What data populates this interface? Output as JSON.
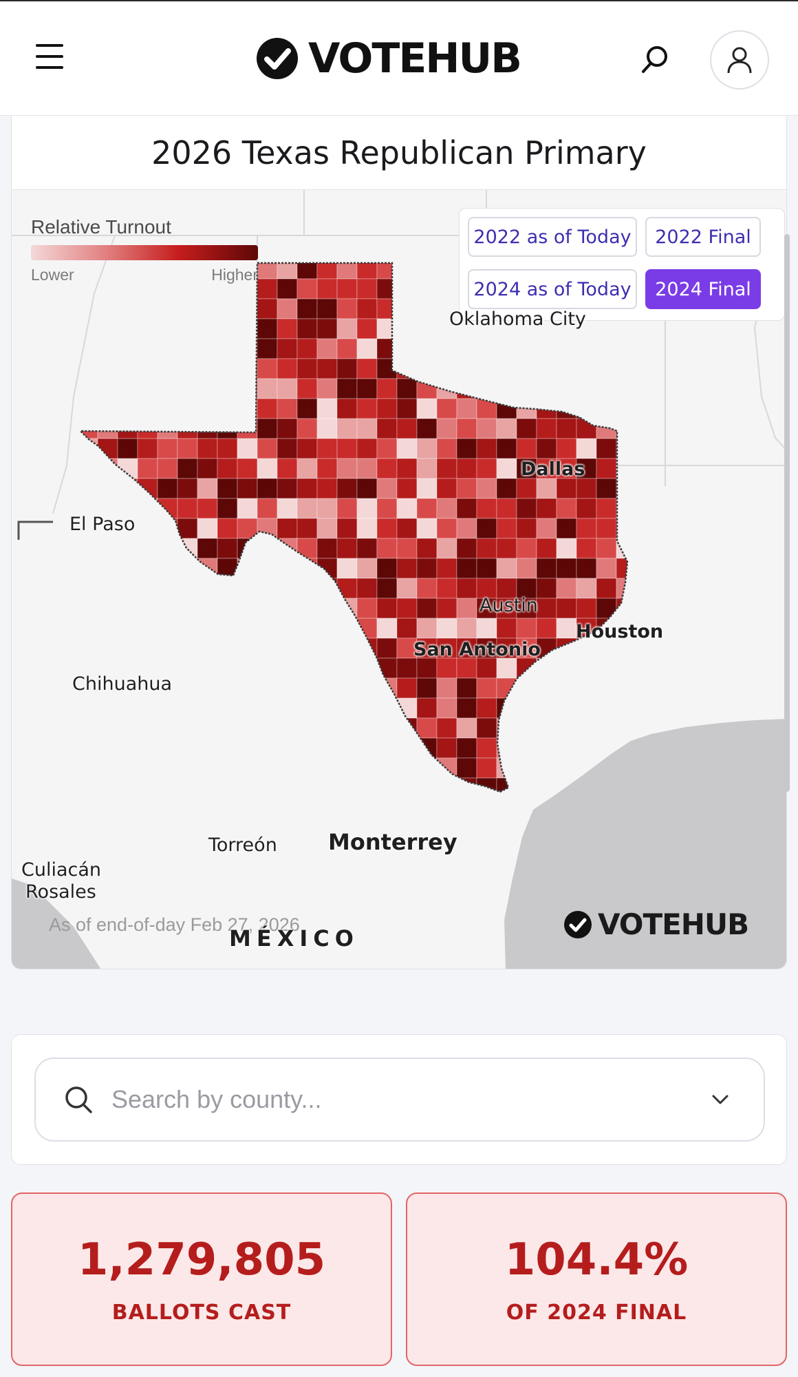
{
  "header": {
    "logo_text": "VOTEHUB",
    "menu_icon": "hamburger-icon",
    "search_icon": "search-icon",
    "account_icon": "user-icon"
  },
  "map": {
    "title": "2026 Texas Republican Primary",
    "legend": {
      "title": "Relative Turnout",
      "low": "Lower",
      "high": "Higher"
    },
    "toggles": [
      {
        "label": "2022 as of Today",
        "active": false
      },
      {
        "label": "2022 Final",
        "active": false
      },
      {
        "label": "2024 as of Today",
        "active": false
      },
      {
        "label": "2024 Final",
        "active": true
      }
    ],
    "cities": {
      "oklahoma_city": "Oklahoma City",
      "dallas": "Dallas",
      "el_paso": "El Paso",
      "austin": "Austin",
      "houston": "Houston",
      "san_antonio": "San Antonio",
      "chihuahua": "Chihuahua",
      "torreon": "Torreón",
      "monterrey": "Monterrey",
      "culiacan": "Culiacán",
      "rosales": "Rosales",
      "mexico": "MÉXICO"
    },
    "as_of": "As of end-of-day Feb 27, 2026",
    "watermark": "VOTEHUB",
    "colors": {
      "low": "#f4d8d8",
      "mid": "#d23a3a",
      "high": "#5e0707"
    }
  },
  "search": {
    "placeholder": "Search by county..."
  },
  "stats": [
    {
      "value": "1,279,805",
      "label": "BALLOTS CAST"
    },
    {
      "value": "104.4%",
      "label": "OF 2024 FINAL"
    }
  ],
  "accent": {
    "purple": "#7a3ce6",
    "red": "#b51d1d"
  }
}
